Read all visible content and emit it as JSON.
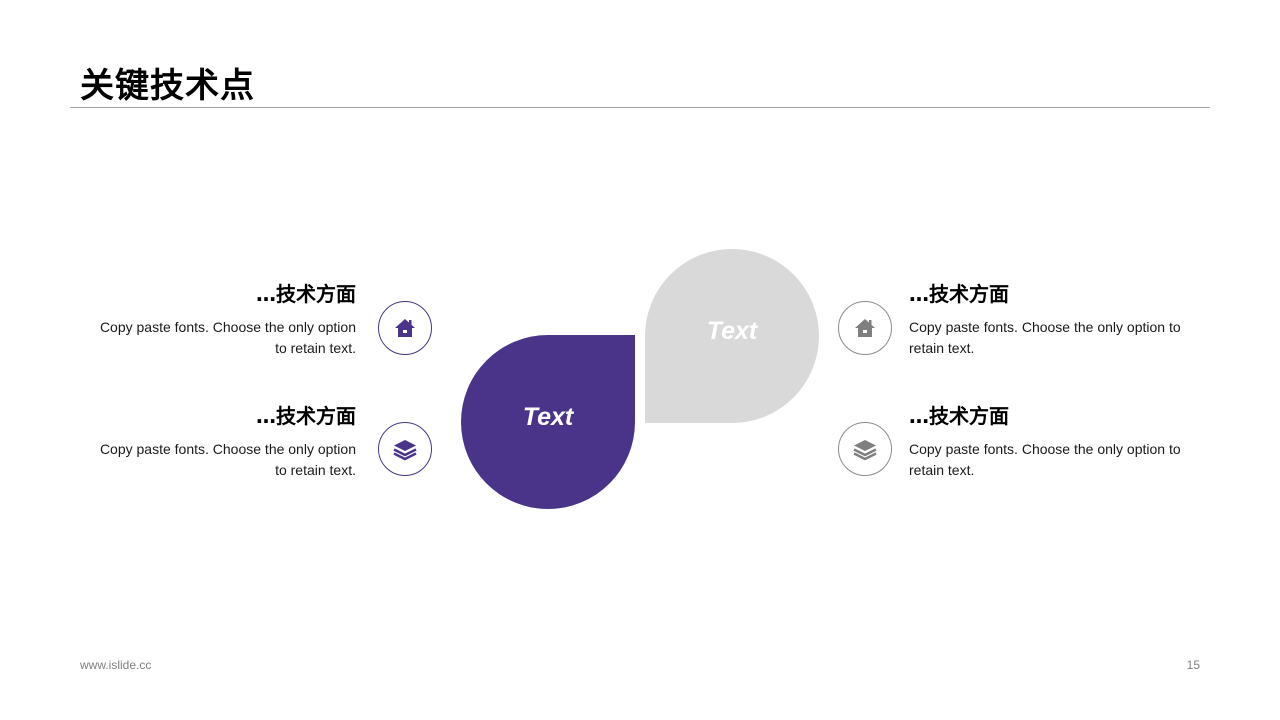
{
  "slide": {
    "title": "关键技术点",
    "footer_url": "www.islide.cc",
    "page_number": "15"
  },
  "colors": {
    "accent": "#4a348a",
    "neutral": "#d9d9d9",
    "gray_icon": "#7f7f7f"
  },
  "drops": {
    "purple_label": "Text",
    "gray_label": "Text"
  },
  "items": [
    {
      "heading": "…技术方面",
      "body": "Copy paste fonts. Choose the only option to retain text.",
      "icon": "home-icon"
    },
    {
      "heading": "…技术方面",
      "body": "Copy paste fonts. Choose the only option to retain text.",
      "icon": "layers-icon"
    },
    {
      "heading": "…技术方面",
      "body": "Copy paste fonts. Choose the only option to retain text.",
      "icon": "home-icon"
    },
    {
      "heading": "…技术方面",
      "body": "Copy paste fonts. Choose the only option to retain text.",
      "icon": "layers-icon"
    }
  ]
}
